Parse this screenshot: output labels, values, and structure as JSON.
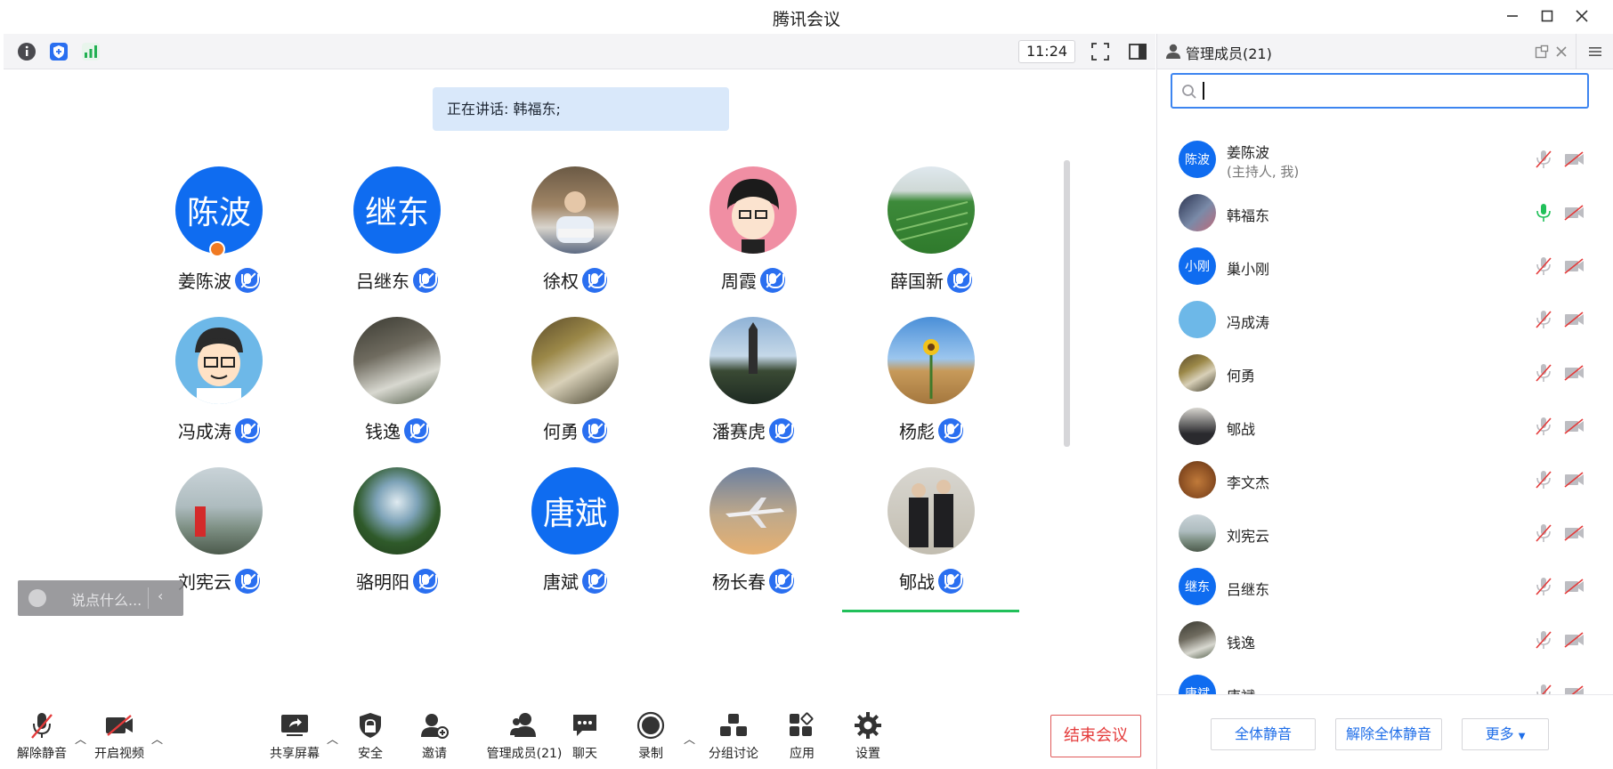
{
  "window": {
    "title": "腾讯会议"
  },
  "topbar": {
    "time": "11:24"
  },
  "speaking": {
    "text": "正在讲话: 韩福东;"
  },
  "grid": {
    "tiles": [
      {
        "name": "姜陈波",
        "avatar_text": "陈波"
      },
      {
        "name": "吕继东",
        "avatar_text": "继东"
      },
      {
        "name": "徐权",
        "avatar_text": ""
      },
      {
        "name": "周霞",
        "avatar_text": ""
      },
      {
        "name": "薛国新",
        "avatar_text": ""
      },
      {
        "name": "冯成涛",
        "avatar_text": ""
      },
      {
        "name": "钱逸",
        "avatar_text": ""
      },
      {
        "name": "何勇",
        "avatar_text": ""
      },
      {
        "name": "潘赛虎",
        "avatar_text": ""
      },
      {
        "name": "杨彪",
        "avatar_text": ""
      },
      {
        "name": "刘宪云",
        "avatar_text": ""
      },
      {
        "name": "骆明阳",
        "avatar_text": ""
      },
      {
        "name": "唐斌",
        "avatar_text": "唐斌"
      },
      {
        "name": "杨长春",
        "avatar_text": ""
      },
      {
        "name": "郇战",
        "avatar_text": ""
      }
    ]
  },
  "chat": {
    "placeholder": "说点什么..."
  },
  "toolbar": {
    "unmute": "解除静音",
    "video": "开启视频",
    "share": "共享屏幕",
    "security": "安全",
    "invite": "邀请",
    "members": "管理成员(21)",
    "chat": "聊天",
    "record": "录制",
    "breakout": "分组讨论",
    "apps": "应用",
    "settings": "设置",
    "end": "结束会议"
  },
  "panel": {
    "title": "管理成员(21)",
    "search_value": "",
    "participants": [
      {
        "name": "姜陈波",
        "sub": "(主持人, 我)",
        "avatar_text": "陈波"
      },
      {
        "name": "韩福东",
        "sub": "",
        "avatar_text": ""
      },
      {
        "name": "巢小刚",
        "sub": "",
        "avatar_text": "小刚"
      },
      {
        "name": "冯成涛",
        "sub": "",
        "avatar_text": ""
      },
      {
        "name": "何勇",
        "sub": "",
        "avatar_text": ""
      },
      {
        "name": "郇战",
        "sub": "",
        "avatar_text": ""
      },
      {
        "name": "李文杰",
        "sub": "",
        "avatar_text": ""
      },
      {
        "name": "刘宪云",
        "sub": "",
        "avatar_text": ""
      },
      {
        "name": "吕继东",
        "sub": "",
        "avatar_text": "继东"
      },
      {
        "name": "钱逸",
        "sub": "",
        "avatar_text": ""
      },
      {
        "name": "唐斌",
        "sub": "",
        "avatar_text": "唐斌"
      }
    ],
    "footer": {
      "mute_all": "全体静音",
      "unmute_all": "解除全体静音",
      "more": "更多"
    }
  },
  "colors": {
    "accent": "#0f6cf0",
    "end": "#e43b3b",
    "speaking_bg": "#d9e8fa",
    "active_line": "#21c05a"
  }
}
